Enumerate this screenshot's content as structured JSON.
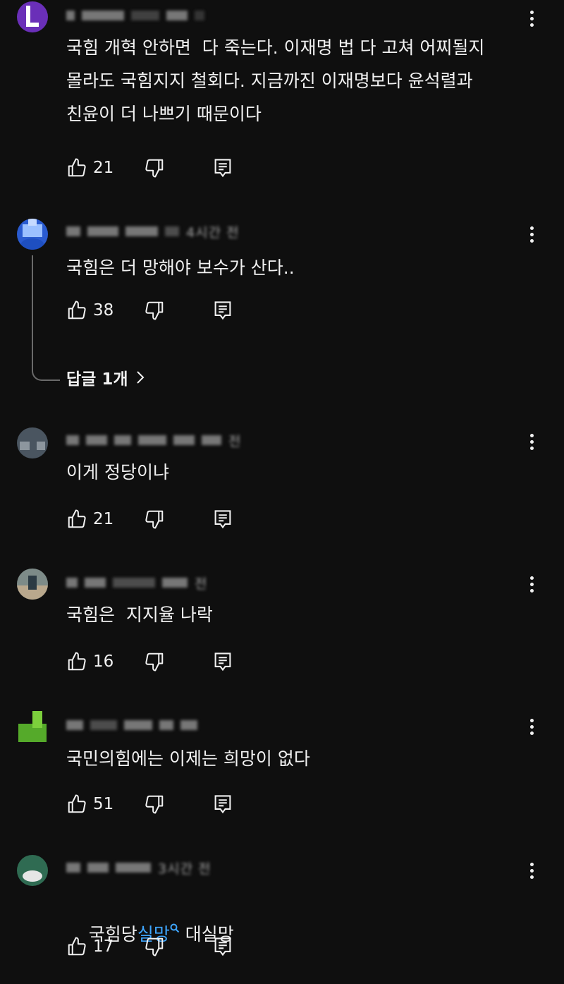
{
  "comments": [
    {
      "author_blurred": "■■■■ ■ ■■",
      "time": "",
      "text": "국힘 개혁 안하면  다 죽는다. 이재명 법 다 고쳐 어찌될지\n몰라도 국힘지지 철회다. 지금까진 이재명보다 윤석렬과\n친윤이 더 나쁘기 때문이다",
      "likes": "21",
      "avatar_color": "#6a2fb8"
    },
    {
      "author_blurred": "■ ■■■ ■■■ ■",
      "time": "4시간 전",
      "text": "국힘은 더 망해야 보수가 산다..",
      "likes": "38",
      "avatar_color": "#4a7ee0",
      "replies_label": "답글 1개"
    },
    {
      "author_blurred": "■ ■■ ■ ■■■ ■",
      "time": "전",
      "text": "이게 정당이냐",
      "likes": "21",
      "avatar_color": "#4a5560"
    },
    {
      "author_blurred": "■ ■■ ■■■ ■",
      "time": "전",
      "text": "국힘은  지지율 나락",
      "likes": "16",
      "avatar_color": "#6b7a78"
    },
    {
      "author_blurred": "■■ ■ ■■ ■ ■",
      "time": "",
      "text": "국민의힘에는 이제는 희망이 없다",
      "likes": "51",
      "avatar_color": "#55aa2a"
    },
    {
      "author_blurred": "■ ■■ ■■■",
      "time": "3시간 전",
      "text_before": "국힘당",
      "text_link": "실망",
      "text_after": " 대실망",
      "likes": "17",
      "avatar_color": "#2f6b52"
    }
  ]
}
